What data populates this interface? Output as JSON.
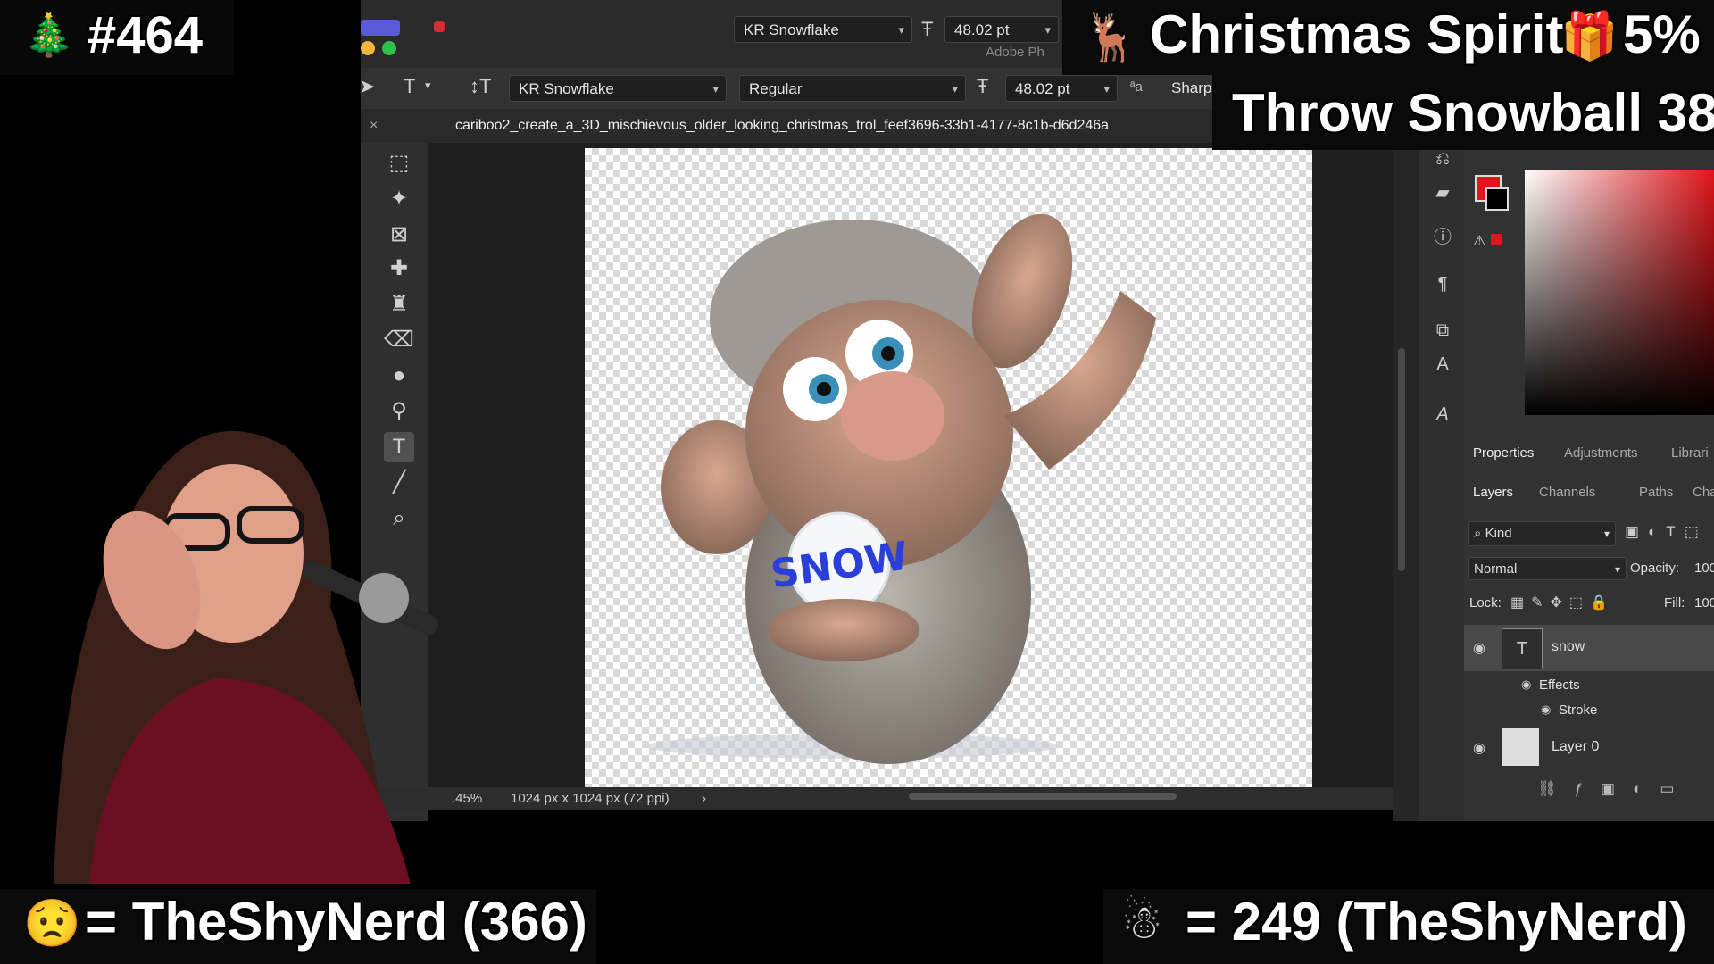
{
  "overlay": {
    "episode": "#464",
    "spirit": "Christmas Spirit",
    "spirit_pct": "5%",
    "throw": "Throw Snowball 38",
    "left_stat": "= TheShyNerd (366)",
    "right_stat": "=  249 (TheShyNerd)"
  },
  "titlebar": {
    "font_name": "KR Snowflake",
    "font_size": "48.02 pt",
    "app_title": "Adobe Ph"
  },
  "options_bar": {
    "font_family": "KR Snowflake",
    "font_style": "Regular",
    "font_size": "48.02 pt",
    "aa_label": "ªa",
    "aa_method": "Sharp"
  },
  "doc_tab": {
    "title": "cariboo2_create_a_3D_mischievous_older_looking_christmas_trol_feef3696-33b1-4177-8c1b-d6d246a"
  },
  "canvas": {
    "snowball_text": "SNOW"
  },
  "status": {
    "zoom": ".45%",
    "dimensions": "1024 px x 1024 px (72 ppi)",
    "arrow": "›"
  },
  "panels": {
    "top_tabs": [
      "Properties",
      "Adjustments",
      "Librari"
    ],
    "layer_tabs": [
      "Layers",
      "Channels",
      "Paths",
      "Char"
    ],
    "kind": "Kind",
    "blend": "Normal",
    "opacity_label": "Opacity:",
    "opacity_value": "100",
    "lock_label": "Lock:",
    "fill_label": "Fill:",
    "fill_value": "100",
    "layers": [
      {
        "name": "snow"
      },
      {
        "name": "Effects"
      },
      {
        "name": "Stroke"
      },
      {
        "name": "Layer 0"
      }
    ]
  },
  "colors": {
    "foreground": "#e0161b",
    "background": "#000000",
    "accent_gold": "#ffd000"
  }
}
